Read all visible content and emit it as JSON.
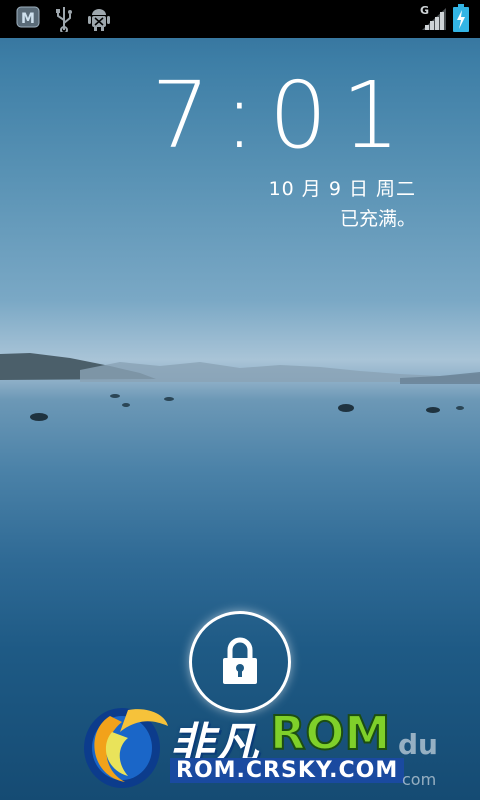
{
  "status_bar": {
    "left_icons": [
      "m-app-icon",
      "usb-icon",
      "android-debug-icon"
    ],
    "network_type": "G",
    "signal_icon": "signal-bars-icon",
    "battery_icon": "battery-charging-icon"
  },
  "lockscreen": {
    "time": "7:01",
    "date": "10 月 9 日 周二",
    "charge_status": "已充满。",
    "unlock_icon": "lock-icon"
  },
  "watermark": {
    "brand_cn": "非凡",
    "brand_rom": "ROM",
    "url": "ROM.CRSKY.COM",
    "faded_text": "du",
    "faded_sub": "com"
  },
  "colors": {
    "status_bar_bg": "#000000",
    "text": "#ffffff",
    "brand_green": "#7fd02a",
    "brand_blue": "#1a4aa0",
    "battery_cyan": "#33b5e5"
  }
}
